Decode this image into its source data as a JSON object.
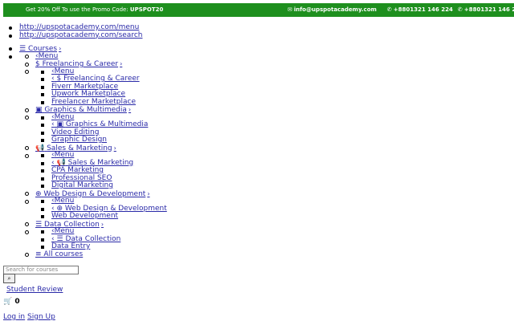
{
  "topbar": {
    "promo_text": "Get 20% Off To use the Promo Code:",
    "promo_code": "UPSPOT20",
    "email": "info@upspotacademy.com",
    "phone1": "+8801321 146 224",
    "phone2": "+8801321 146 22",
    "bg_color": "#1e8f1e"
  },
  "links": [
    "http://upspotacademy.com/menu",
    "http://upspotacademy.com/search"
  ],
  "menu": {
    "courses": "Courses",
    "menu_label": "Menu",
    "categories": [
      {
        "label": "Freelancing & Career",
        "icon": "dollar-icon",
        "items": [
          "Fiverr Marketplace",
          "Upwork Marketplace",
          "Freelancer Marketplace"
        ]
      },
      {
        "label": "Graphics & Multimedia",
        "icon": "image-icon",
        "items": [
          "Video Editing",
          "Graphic Design"
        ]
      },
      {
        "label": "Sales & Marketing",
        "icon": "bullhorn-icon",
        "items": [
          "CPA Marketing",
          "Professional SEO",
          "Digital Marketing"
        ]
      },
      {
        "label": "Web Design & Development",
        "icon": "globe-icon",
        "items": [
          "Web Development"
        ]
      },
      {
        "label": "Data Collection",
        "icon": "database-icon",
        "items": [
          "Data Entry"
        ]
      }
    ],
    "all_courses": "All courses"
  },
  "search": {
    "placeholder": "Search for courses"
  },
  "student_review": "Student Review",
  "cart_count": "0",
  "login": "Log in",
  "signup": "Sign Up"
}
